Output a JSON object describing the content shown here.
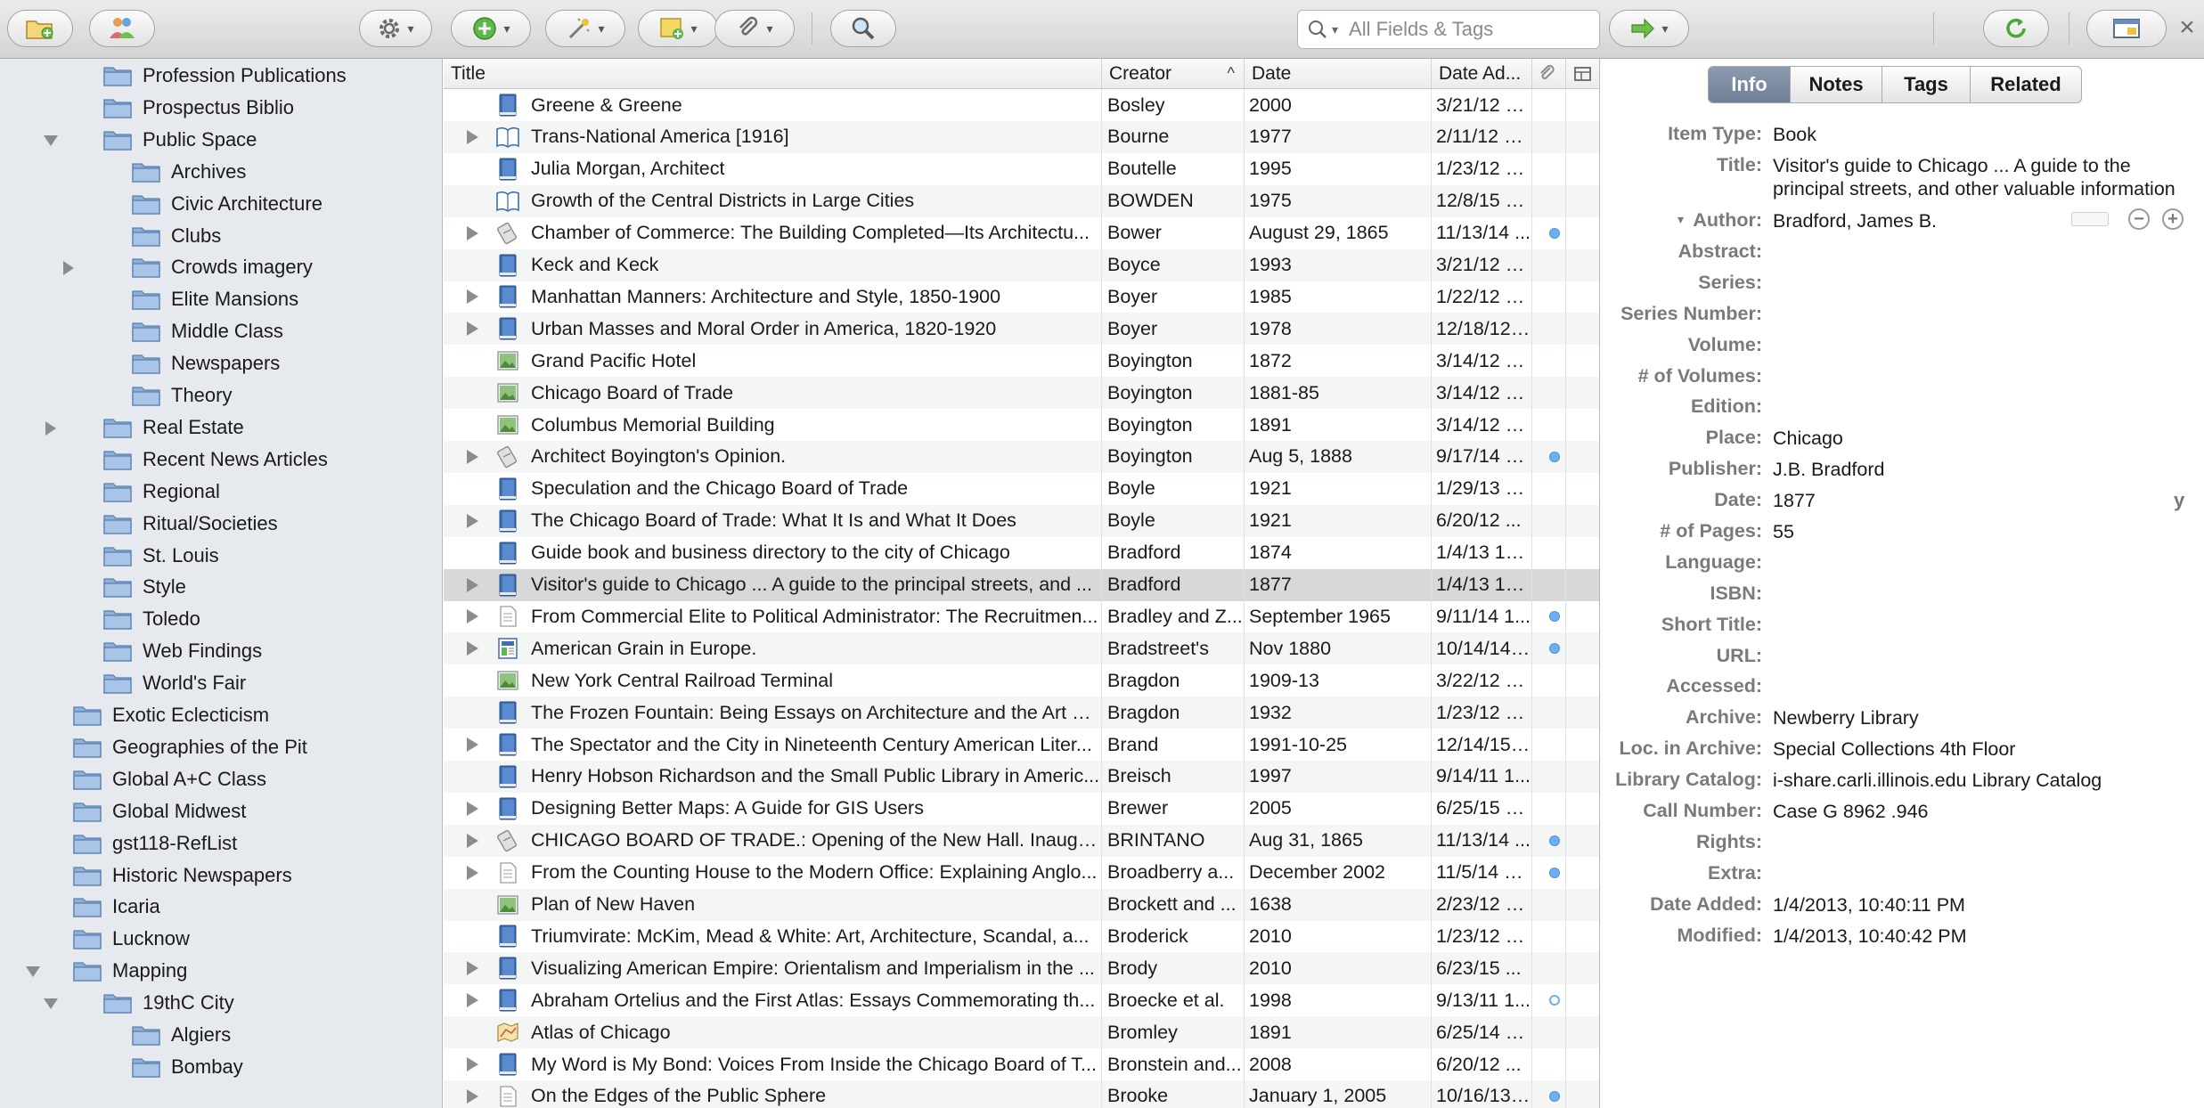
{
  "toolbar": {
    "search_placeholder": "All Fields & Tags"
  },
  "collections": [
    {
      "label": "Profession Publications",
      "depth": 2,
      "twisty": ""
    },
    {
      "label": "Prospectus Biblio",
      "depth": 2,
      "twisty": ""
    },
    {
      "label": "Public Space",
      "depth": 2,
      "twisty": "open"
    },
    {
      "label": "Archives",
      "depth": 3,
      "twisty": ""
    },
    {
      "label": "Civic Architecture",
      "depth": 3,
      "twisty": ""
    },
    {
      "label": "Clubs",
      "depth": 3,
      "twisty": ""
    },
    {
      "label": "Crowds imagery",
      "depth": 3,
      "twisty": "closed"
    },
    {
      "label": "Elite Mansions",
      "depth": 3,
      "twisty": ""
    },
    {
      "label": "Middle Class",
      "depth": 3,
      "twisty": ""
    },
    {
      "label": "Newspapers",
      "depth": 3,
      "twisty": ""
    },
    {
      "label": "Theory",
      "depth": 3,
      "twisty": ""
    },
    {
      "label": "Real Estate",
      "depth": 2,
      "twisty": "closed"
    },
    {
      "label": "Recent News Articles",
      "depth": 2,
      "twisty": ""
    },
    {
      "label": "Regional",
      "depth": 2,
      "twisty": ""
    },
    {
      "label": "Ritual/Societies",
      "depth": 2,
      "twisty": ""
    },
    {
      "label": "St. Louis",
      "depth": 2,
      "twisty": ""
    },
    {
      "label": "Style",
      "depth": 2,
      "twisty": ""
    },
    {
      "label": "Toledo",
      "depth": 2,
      "twisty": ""
    },
    {
      "label": "Web Findings",
      "depth": 2,
      "twisty": ""
    },
    {
      "label": "World's Fair",
      "depth": 2,
      "twisty": ""
    },
    {
      "label": "Exotic Eclecticism",
      "depth": 1,
      "twisty": ""
    },
    {
      "label": "Geographies of the Pit",
      "depth": 1,
      "twisty": ""
    },
    {
      "label": "Global A+C Class",
      "depth": 1,
      "twisty": ""
    },
    {
      "label": "Global Midwest",
      "depth": 1,
      "twisty": ""
    },
    {
      "label": "gst118-RefList",
      "depth": 1,
      "twisty": ""
    },
    {
      "label": "Historic Newspapers",
      "depth": 1,
      "twisty": ""
    },
    {
      "label": "Icaria",
      "depth": 1,
      "twisty": ""
    },
    {
      "label": "Lucknow",
      "depth": 1,
      "twisty": ""
    },
    {
      "label": "Mapping",
      "depth": 1,
      "twisty": "open"
    },
    {
      "label": "19thC City",
      "depth": 2,
      "twisty": "open"
    },
    {
      "label": "Algiers",
      "depth": 3,
      "twisty": ""
    },
    {
      "label": "Bombay",
      "depth": 3,
      "twisty": ""
    }
  ],
  "items_columns": {
    "title": "Title",
    "creator": "Creator",
    "date": "Date",
    "date_added": "Date Ad..."
  },
  "items": [
    {
      "title": "Greene & Greene",
      "creator": "Bosley",
      "date": "2000",
      "added": "3/21/12 9...",
      "type": "book",
      "twisty": false,
      "dot": ""
    },
    {
      "title": "Trans-National America [1916]",
      "creator": "Bourne",
      "date": "1977",
      "added": "2/11/12 1:...",
      "type": "booksection",
      "twisty": true,
      "dot": ""
    },
    {
      "title": "Julia Morgan, Architect",
      "creator": "Boutelle",
      "date": "1995",
      "added": "1/23/12 7...",
      "type": "book",
      "twisty": false,
      "dot": ""
    },
    {
      "title": "Growth of the Central Districts in Large Cities",
      "creator": "BOWDEN",
      "date": "1975",
      "added": "12/8/15 1...",
      "type": "booksection",
      "twisty": false,
      "dot": ""
    },
    {
      "title": "Chamber of Commerce: The Building Completed—Its Architectu...",
      "creator": "Bower",
      "date": "August 29, 1865",
      "added": "11/13/14 ...",
      "type": "newspaper",
      "twisty": true,
      "dot": "full"
    },
    {
      "title": "Keck and Keck",
      "creator": "Boyce",
      "date": "1993",
      "added": "3/21/12 1...",
      "type": "book",
      "twisty": false,
      "dot": ""
    },
    {
      "title": "Manhattan Manners: Architecture and Style, 1850-1900",
      "creator": "Boyer",
      "date": "1985",
      "added": "1/22/12 7...",
      "type": "book",
      "twisty": true,
      "dot": ""
    },
    {
      "title": "Urban Masses and Moral Order in America, 1820-1920",
      "creator": "Boyer",
      "date": "1978",
      "added": "12/18/12 ...",
      "type": "book",
      "twisty": true,
      "dot": ""
    },
    {
      "title": "Grand Pacific Hotel",
      "creator": "Boyington",
      "date": "1872",
      "added": "3/14/12 7...",
      "type": "image",
      "twisty": false,
      "dot": ""
    },
    {
      "title": "Chicago Board of Trade",
      "creator": "Boyington",
      "date": "1881-85",
      "added": "3/14/12 7...",
      "type": "image",
      "twisty": false,
      "dot": ""
    },
    {
      "title": "Columbus Memorial Building",
      "creator": "Boyington",
      "date": "1891",
      "added": "3/14/12 7...",
      "type": "image",
      "twisty": false,
      "dot": ""
    },
    {
      "title": "Architect Boyington's Opinion.",
      "creator": "Boyington",
      "date": "Aug 5, 1888",
      "added": "9/17/14 2...",
      "type": "newspaper",
      "twisty": true,
      "dot": "full"
    },
    {
      "title": "Speculation and the Chicago Board of Trade",
      "creator": "Boyle",
      "date": "1921",
      "added": "1/29/13 1...",
      "type": "book",
      "twisty": false,
      "dot": ""
    },
    {
      "title": "The Chicago Board of Trade: What It Is and What It Does",
      "creator": "Boyle",
      "date": "1921",
      "added": "6/20/12 ...",
      "type": "book",
      "twisty": true,
      "dot": ""
    },
    {
      "title": "Guide book and business directory to the city of Chicago",
      "creator": "Bradford",
      "date": "1874",
      "added": "1/4/13 10...",
      "type": "book",
      "twisty": false,
      "dot": ""
    },
    {
      "title": "Visitor's guide to Chicago ... A guide to the principal streets, and ...",
      "creator": "Bradford",
      "date": "1877",
      "added": "1/4/13 10...",
      "type": "book",
      "twisty": true,
      "dot": "",
      "selected": true
    },
    {
      "title": "From Commercial Elite to Political Administrator: The Recruitmen...",
      "creator": "Bradley and Z...",
      "date": "September 1965",
      "added": "9/11/14 1...",
      "type": "article",
      "twisty": true,
      "dot": "full"
    },
    {
      "title": "American Grain in Europe.",
      "creator": "Bradstreet's",
      "date": "Nov 1880",
      "added": "10/14/14 ...",
      "type": "magazine",
      "twisty": true,
      "dot": "full"
    },
    {
      "title": "New York Central Railroad Terminal",
      "creator": "Bragdon",
      "date": "1909-13",
      "added": "3/22/12 1...",
      "type": "image",
      "twisty": false,
      "dot": ""
    },
    {
      "title": "The Frozen Fountain: Being Essays on Architecture and the Art of...",
      "creator": "Bragdon",
      "date": "1932",
      "added": "1/23/12 7...",
      "type": "book",
      "twisty": false,
      "dot": ""
    },
    {
      "title": "The Spectator and the City in Nineteenth Century American Liter...",
      "creator": "Brand",
      "date": "1991-10-25",
      "added": "12/14/15 ...",
      "type": "book",
      "twisty": true,
      "dot": ""
    },
    {
      "title": "Henry Hobson Richardson and the Small Public Library in Americ...",
      "creator": "Breisch",
      "date": "1997",
      "added": "9/14/11 1...",
      "type": "book",
      "twisty": false,
      "dot": ""
    },
    {
      "title": "Designing Better Maps: A Guide for GIS Users",
      "creator": "Brewer",
      "date": "2005",
      "added": "6/25/15 1...",
      "type": "book",
      "twisty": true,
      "dot": ""
    },
    {
      "title": "CHICAGO BOARD OF TRADE.: Opening of the New Hall. Inaugur...",
      "creator": "BRINTANO",
      "date": "Aug 31, 1865",
      "added": "11/13/14 ...",
      "type": "newspaper",
      "twisty": true,
      "dot": "full"
    },
    {
      "title": "From the Counting House to the Modern Office: Explaining Anglo...",
      "creator": "Broadberry a...",
      "date": "December 2002",
      "added": "11/5/14 5:...",
      "type": "article",
      "twisty": true,
      "dot": "full"
    },
    {
      "title": "Plan of New Haven",
      "creator": "Brockett and ...",
      "date": "1638",
      "added": "2/23/12 4...",
      "type": "image",
      "twisty": false,
      "dot": ""
    },
    {
      "title": "Triumvirate: McKim, Mead & White: Art, Architecture, Scandal, a...",
      "creator": "Broderick",
      "date": "2010",
      "added": "1/23/12 7...",
      "type": "book",
      "twisty": false,
      "dot": ""
    },
    {
      "title": "Visualizing American Empire: Orientalism and Imperialism in the ...",
      "creator": "Brody",
      "date": "2010",
      "added": "6/23/15 ...",
      "type": "book",
      "twisty": true,
      "dot": ""
    },
    {
      "title": "Abraham Ortelius and the First Atlas: Essays Commemorating th...",
      "creator": "Broecke et al.",
      "date": "1998",
      "added": "9/13/11 1...",
      "type": "book",
      "twisty": true,
      "dot": "hollow"
    },
    {
      "title": "Atlas of Chicago",
      "creator": "Bromley",
      "date": "1891",
      "added": "6/25/14 1...",
      "type": "map",
      "twisty": false,
      "dot": ""
    },
    {
      "title": "My Word is My Bond: Voices From Inside the Chicago Board of T...",
      "creator": "Bronstein and...",
      "date": "2008",
      "added": "6/20/12 ...",
      "type": "book",
      "twisty": true,
      "dot": ""
    },
    {
      "title": "On the Edges of the Public Sphere",
      "creator": "Brooke",
      "date": "January 1, 2005",
      "added": "10/16/13 ...",
      "type": "article",
      "twisty": true,
      "dot": "full"
    }
  ],
  "item_pane": {
    "tabs": [
      "Info",
      "Notes",
      "Tags",
      "Related"
    ],
    "fields": [
      {
        "label": "Item Type:",
        "value": ""
      },
      {
        "label": "Title:",
        "value": ""
      },
      {
        "label": "Author:",
        "value": ""
      },
      {
        "label": "Abstract:",
        "value": ""
      },
      {
        "label": "Series:",
        "value": ""
      },
      {
        "label": "Series Number:",
        "value": ""
      },
      {
        "label": "Volume:",
        "value": ""
      },
      {
        "label": "# of Volumes:",
        "value": ""
      },
      {
        "label": "Edition:",
        "value": ""
      },
      {
        "label": "Place:",
        "value": ""
      },
      {
        "label": "Publisher:",
        "value": ""
      },
      {
        "label": "Date:",
        "value": ""
      },
      {
        "label": "# of Pages:",
        "value": ""
      },
      {
        "label": "Language:",
        "value": ""
      },
      {
        "label": "ISBN:",
        "value": ""
      },
      {
        "label": "Short Title:",
        "value": ""
      },
      {
        "label": "URL:",
        "value": ""
      },
      {
        "label": "Accessed:",
        "value": ""
      },
      {
        "label": "Archive:",
        "value": ""
      },
      {
        "label": "Loc. in Archive:",
        "value": ""
      },
      {
        "label": "Library Catalog:",
        "value": ""
      },
      {
        "label": "Call Number:",
        "value": ""
      },
      {
        "label": "Rights:",
        "value": ""
      },
      {
        "label": "Extra:",
        "value": ""
      },
      {
        "label": "Date Added:",
        "value": ""
      },
      {
        "label": "Modified:",
        "value": ""
      }
    ],
    "values": {
      "item_type": "Book",
      "title_line1": "Visitor's guide to Chicago ... A guide to the",
      "title_line2": "principal streets, and other valuable information",
      "author": "Bradford, James B.",
      "place": "Chicago",
      "publisher": "J.B. Bradford",
      "date": "1877",
      "date_flag": "y",
      "pages": "55",
      "archive": "Newberry Library",
      "loc_in_archive": "Special Collections 4th Floor",
      "library_catalog": "i-share.carli.illinois.edu Library Catalog",
      "call_number": "Case G 8962 .946",
      "date_added": "1/4/2013, 10:40:11 PM",
      "modified": "1/4/2013, 10:40:42 PM"
    }
  }
}
